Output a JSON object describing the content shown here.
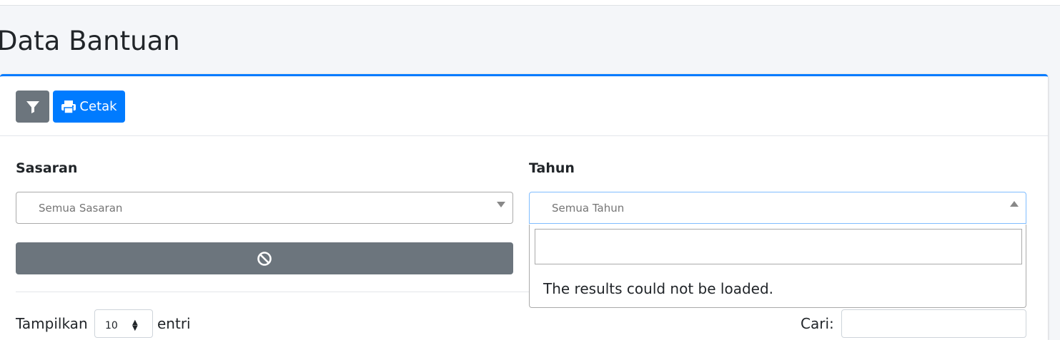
{
  "page": {
    "title": "Data Bantuan"
  },
  "toolbar": {
    "print_label": "Cetak"
  },
  "filters": {
    "sasaran": {
      "label": "Sasaran",
      "placeholder": "Semua Sasaran"
    },
    "tahun": {
      "label": "Tahun",
      "placeholder": "Semua Tahun"
    }
  },
  "dropdown": {
    "search_value": "",
    "message": "The results could not be loaded."
  },
  "table_controls": {
    "show_prefix": "Tampilkan",
    "page_length": "10",
    "show_suffix": "entri",
    "search_label": "Cari:",
    "search_value": ""
  },
  "colors": {
    "primary": "#007bff",
    "secondary": "#6c757d",
    "background": "#f4f6f9"
  },
  "icons": {
    "filter": "filter-icon",
    "print": "print-icon",
    "reset": "ban-icon"
  }
}
